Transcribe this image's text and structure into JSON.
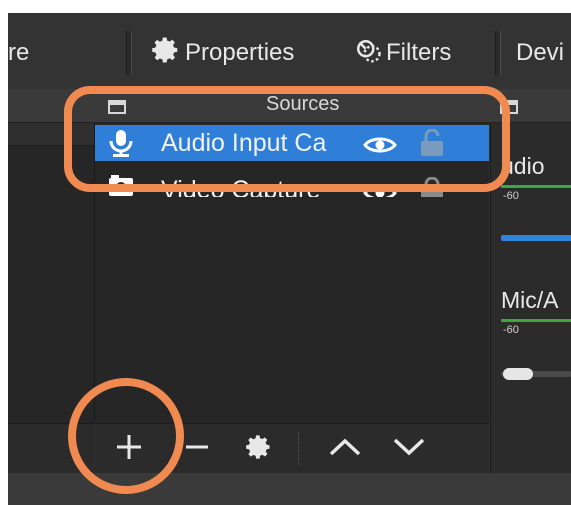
{
  "toolbar": {
    "partial_left_label": "re",
    "properties_label": "Properties",
    "filters_label": "Filters",
    "devices_label": "Devi"
  },
  "docks": {
    "sources_title": "Sources",
    "mixer_title_partial": ""
  },
  "sources": [
    {
      "label": "Audio Input Ca",
      "icon": "microphone-icon",
      "selected": true,
      "visible": true,
      "locked": false
    },
    {
      "label": "Video Capture",
      "icon": "camera-icon",
      "selected": false,
      "visible": true,
      "locked": false
    }
  ],
  "source_actions": {
    "add_icon": "plus-icon",
    "remove_icon": "minus-icon",
    "settings_icon": "gear-icon",
    "up_icon": "chevron-up-icon",
    "down_icon": "chevron-down-icon"
  },
  "mixer": {
    "channels": [
      {
        "name": "udio",
        "scale_start": "-60",
        "volume": 1.0
      },
      {
        "name": "Mic/A",
        "scale_start": "-60",
        "volume": 0.0
      }
    ]
  },
  "colors": {
    "selection": "#2f7ed8",
    "annotation": "#f08a50",
    "meter_green": "#3ea83e"
  }
}
